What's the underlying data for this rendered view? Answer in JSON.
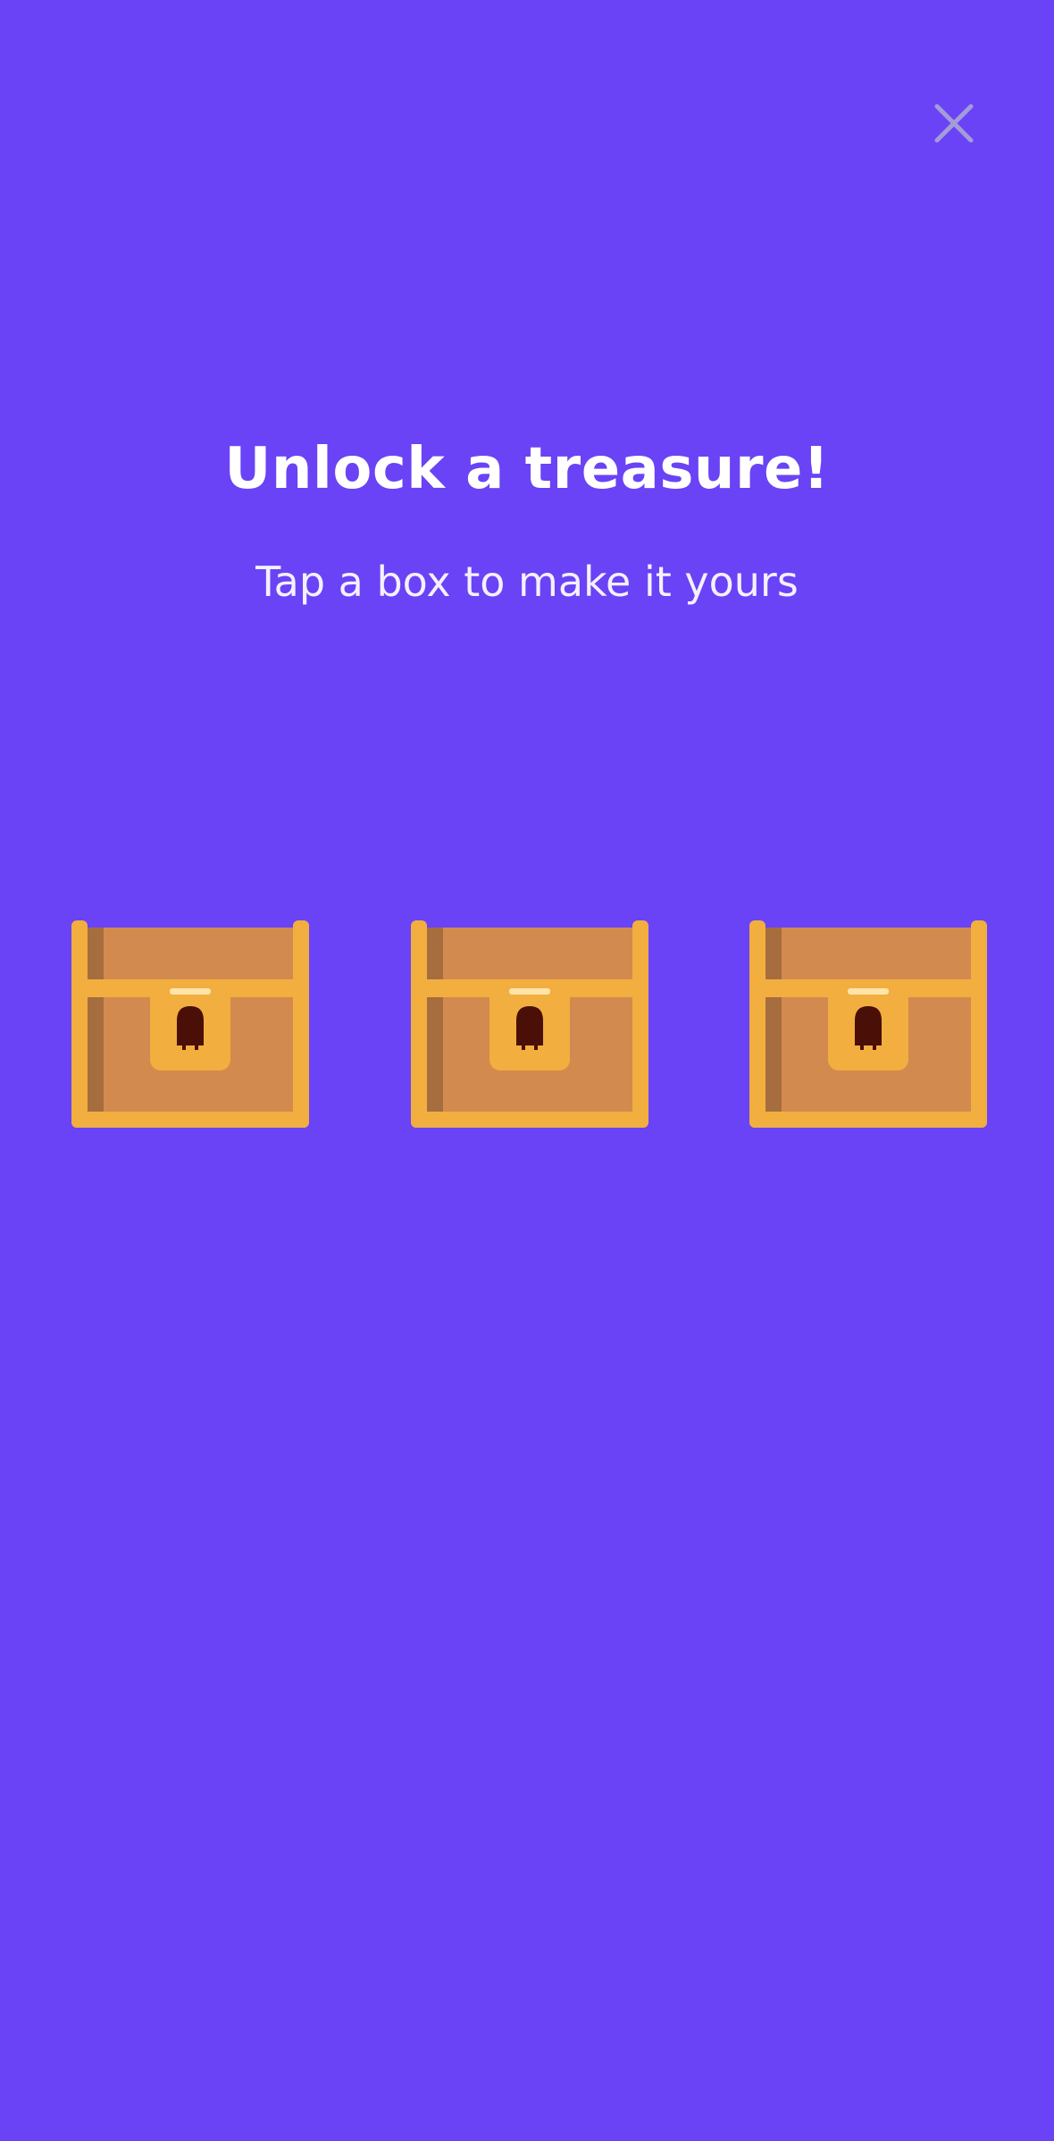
{
  "screen": {
    "background_color": "#6943F5",
    "title": "Unlock a treasure!",
    "subtitle": "Tap a box to make it yours"
  },
  "close_button": {
    "icon": "close-icon",
    "color": "#A49BD9"
  },
  "chests": [
    {
      "icon": "treasure-chest-icon"
    },
    {
      "icon": "treasure-chest-icon"
    },
    {
      "icon": "treasure-chest-icon"
    }
  ],
  "colors": {
    "chest_frame": "#F2AE3F",
    "chest_wood": "#D38A4F",
    "chest_wood_shadow": "#A66E3E",
    "lock_plate": "#F2AE3F",
    "lock_highlight": "#FFE6A8",
    "keyhole": "#4A0F06"
  }
}
